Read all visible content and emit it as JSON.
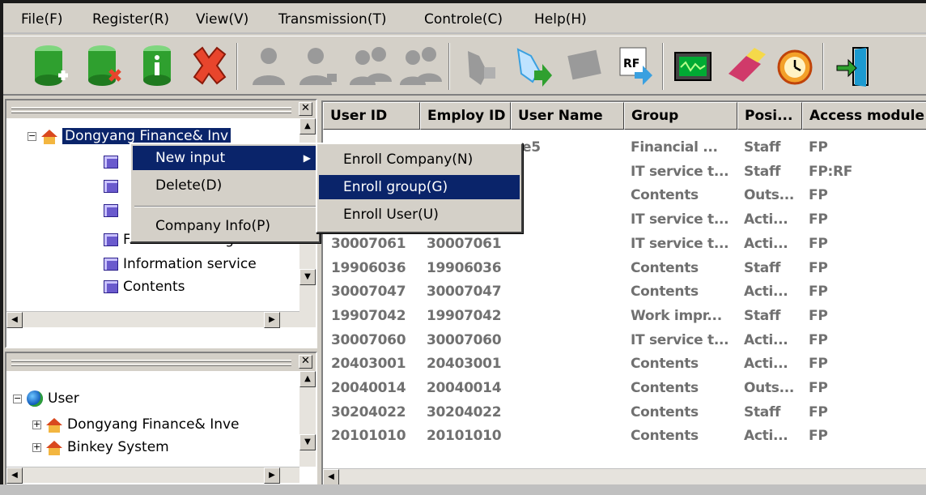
{
  "menu": {
    "items": [
      "File(F)",
      "Register(R)",
      "View(V)",
      "Transmission(T)",
      "Controle(C)",
      "Help(H)"
    ]
  },
  "toolbar": {
    "buttons": [
      {
        "icon": "add-db-icon",
        "color": "#2fa02f"
      },
      {
        "icon": "remove-db-icon",
        "color": "#2fa02f"
      },
      {
        "icon": "db-info-icon",
        "color": "#2fa02f"
      },
      {
        "icon": "delete-icon",
        "color": "#e8452c"
      },
      {
        "icon": "user-icon",
        "color": "#9a9a9a"
      },
      {
        "icon": "user-edit-icon",
        "color": "#9a9a9a"
      },
      {
        "icon": "users-icon",
        "color": "#9a9a9a"
      },
      {
        "icon": "users-remove-icon",
        "color": "#9a9a9a"
      },
      {
        "icon": "hand-download-icon",
        "color": "#9a9a9a"
      },
      {
        "icon": "hand-enroll-icon",
        "color": "#3aa0e0"
      },
      {
        "icon": "card-icon",
        "color": "#9a9a9a"
      },
      {
        "icon": "rf-icon",
        "color": "#3aa0e0"
      },
      {
        "icon": "monitor-icon",
        "color": "#1c8a1c"
      },
      {
        "icon": "eraser-icon",
        "color": "#d03a6a"
      },
      {
        "icon": "clock-icon",
        "color": "#e05a1a"
      },
      {
        "icon": "exit-icon",
        "color": "#1c9ad0"
      }
    ]
  },
  "upper_tree": {
    "root_label": "Dongyang Finance& Inv",
    "items": [
      "Financial Manageme",
      "Information service",
      "Contents"
    ]
  },
  "lower_tree": {
    "root_label": "User",
    "items": [
      "Dongyang Finance& Inve",
      "Binkey System"
    ]
  },
  "context_menu": {
    "items": [
      "New input",
      "Delete(D)",
      "Company Info(P)"
    ],
    "submenu": [
      "Enroll Company(N)",
      "Enroll group(G)",
      "Enroll User(U)"
    ]
  },
  "table": {
    "columns": [
      "User ID",
      "Employ ID",
      "User Name",
      "Group",
      "Posi...",
      "Access module"
    ],
    "rows": [
      {
        "user_id": "",
        "employ_id": "",
        "name": "e5",
        "group": "Financial ...",
        "pos": "Staff",
        "access": "FP"
      },
      {
        "user_id": "",
        "employ_id": "",
        "name": "",
        "group": "IT service t...",
        "pos": "Staff",
        "access": "FP:RF"
      },
      {
        "user_id": "",
        "employ_id": "",
        "name": "",
        "group": "Contents",
        "pos": "Outs...",
        "access": "FP"
      },
      {
        "user_id": "",
        "employ_id": "",
        "name": "",
        "group": "IT service t...",
        "pos": "Acti...",
        "access": "FP"
      },
      {
        "user_id": "30007061",
        "employ_id": "30007061",
        "name": "",
        "group": "IT service t...",
        "pos": "Acti...",
        "access": "FP"
      },
      {
        "user_id": "19906036",
        "employ_id": "19906036",
        "name": "",
        "group": "Contents",
        "pos": "Staff",
        "access": "FP"
      },
      {
        "user_id": "30007047",
        "employ_id": "30007047",
        "name": "",
        "group": "Contents",
        "pos": "Acti...",
        "access": "FP"
      },
      {
        "user_id": "19907042",
        "employ_id": "19907042",
        "name": "",
        "group": "Work impr...",
        "pos": "Staff",
        "access": "FP"
      },
      {
        "user_id": "30007060",
        "employ_id": "30007060",
        "name": "",
        "group": "IT service t...",
        "pos": "Acti...",
        "access": "FP"
      },
      {
        "user_id": "20403001",
        "employ_id": "20403001",
        "name": "",
        "group": "Contents",
        "pos": "Acti...",
        "access": "FP"
      },
      {
        "user_id": "20040014",
        "employ_id": "20040014",
        "name": "",
        "group": "Contents",
        "pos": "Outs...",
        "access": "FP"
      },
      {
        "user_id": "30204022",
        "employ_id": "30204022",
        "name": "",
        "group": "Contents",
        "pos": "Staff",
        "access": "FP"
      },
      {
        "user_id": "20101010",
        "employ_id": "20101010",
        "name": "",
        "group": "Contents",
        "pos": "Acti...",
        "access": "FP"
      }
    ]
  }
}
